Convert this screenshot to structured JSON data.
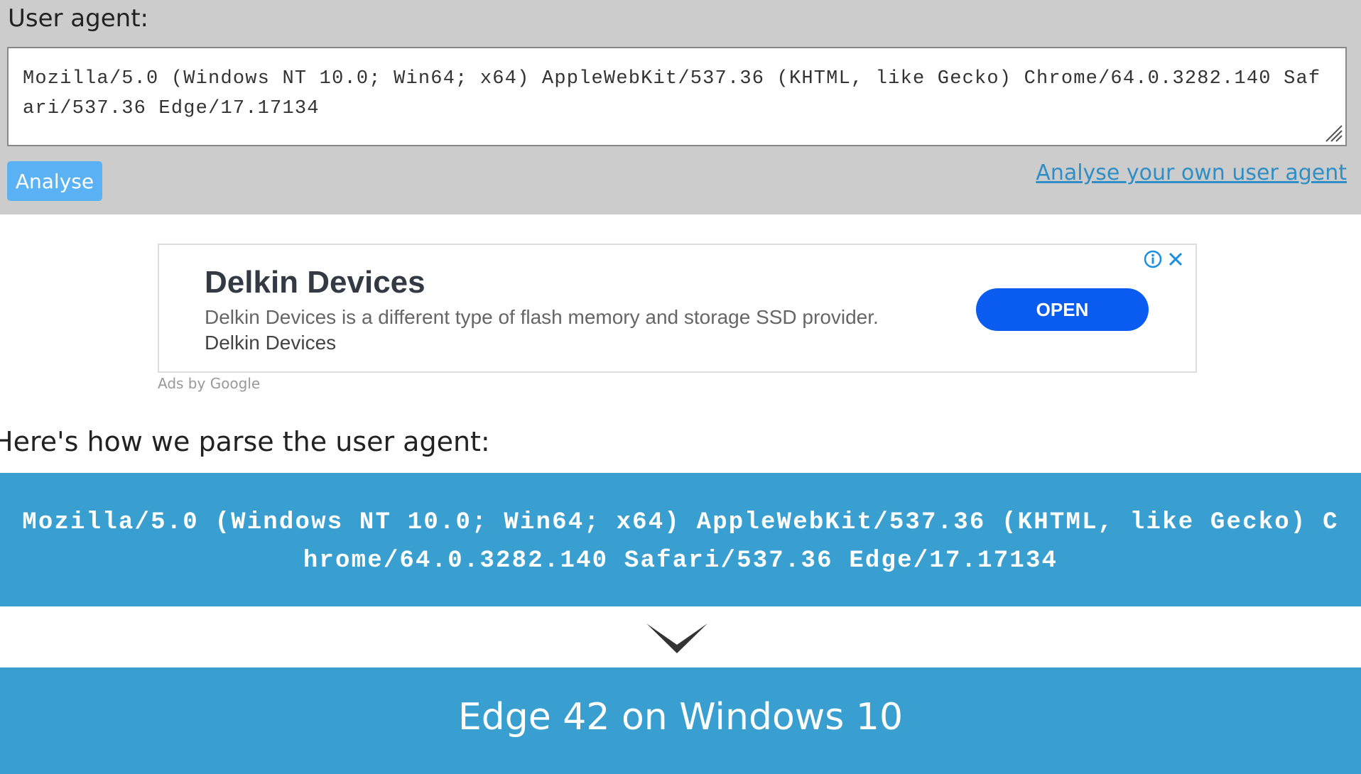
{
  "form": {
    "label": "User agent:",
    "user_agent_value": "Mozilla/5.0 (Windows NT 10.0; Win64; x64) AppleWebKit/537.36 (KHTML, like Gecko) Chrome/64.0.3282.140 Safari/537.36 Edge/17.17134",
    "analyse_button": "Analyse",
    "own_ua_link": "Analyse your own user agent"
  },
  "ad": {
    "title": "Delkin Devices",
    "description": "Delkin Devices is a different type of flash memory and storage SSD provider.",
    "sponsor": "Delkin Devices",
    "open_button": "OPEN",
    "ads_by": "Ads by Google",
    "open_button_color": "#0a5cf0",
    "info_icon": "info-icon",
    "close_icon": "close-icon"
  },
  "parse": {
    "heading": "Here's how we parse the user agent:",
    "ua_string": "Mozilla/5.0 (Windows NT 10.0; Win64; x64) AppleWebKit/537.36 (KHTML, like Gecko) Chrome/64.0.3282.140 Safari/537.36 Edge/17.17134",
    "result": "Edge 42 on Windows 10",
    "arrow_icon": "chevron-down-icon"
  },
  "colors": {
    "top_background": "#cccccc",
    "accent_blue": "#389fd0",
    "button_blue": "#5ab2f5",
    "link_blue": "#2f8ec5"
  }
}
